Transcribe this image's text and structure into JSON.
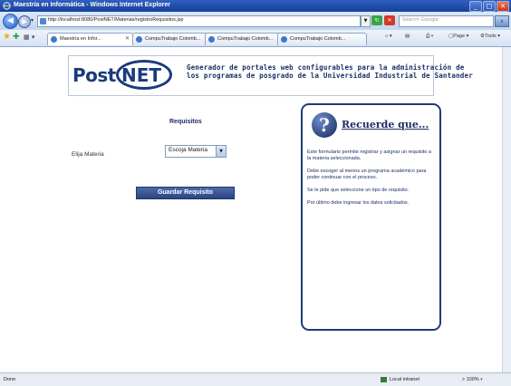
{
  "window": {
    "title": "Maestría en Informática - Windows Internet Explorer",
    "buttons": {
      "minimize": "_",
      "maximize": "□",
      "close": "✕"
    }
  },
  "addressbar": {
    "url": "http://localhost:8080/PostNET/Materias/registroRequisitos.jsp",
    "search_placeholder": "Search Google"
  },
  "tabs": [
    {
      "label": "Maestría en Infor...",
      "active": true
    },
    {
      "label": "CompuTrabajo Colomb...",
      "active": false
    },
    {
      "label": "CompuTrabajo Colomb...",
      "active": false
    },
    {
      "label": "CompuTrabajo Colomb...",
      "active": false
    }
  ],
  "commandbar": {
    "page": "Page",
    "tools": "Tools"
  },
  "banner": {
    "logo_post": "Post",
    "logo_net": "NET",
    "line1": "Generador de portales web configurables para la administración de",
    "line2": "los programas de posgrado de la Universidad Industrial de Santander"
  },
  "form": {
    "title": "Requisitos",
    "label": "Elija Materia",
    "select_value": "Escoja Materia",
    "submit": "Guardar Requisito"
  },
  "help": {
    "icon": "?",
    "title": "Recuerde que...",
    "paragraphs": [
      "Este formulario permite registrar y asignar un requisito a la materia seleccionada.",
      "Debe escoger al menos un programa académico para poder continuar con el proceso.",
      "Se le pide que seleccione un tipo de requisito.",
      "Por último debe ingresar los datos solicitados."
    ]
  },
  "status": {
    "left": "Done",
    "zone": "Local intranet",
    "zoom": "100%"
  }
}
